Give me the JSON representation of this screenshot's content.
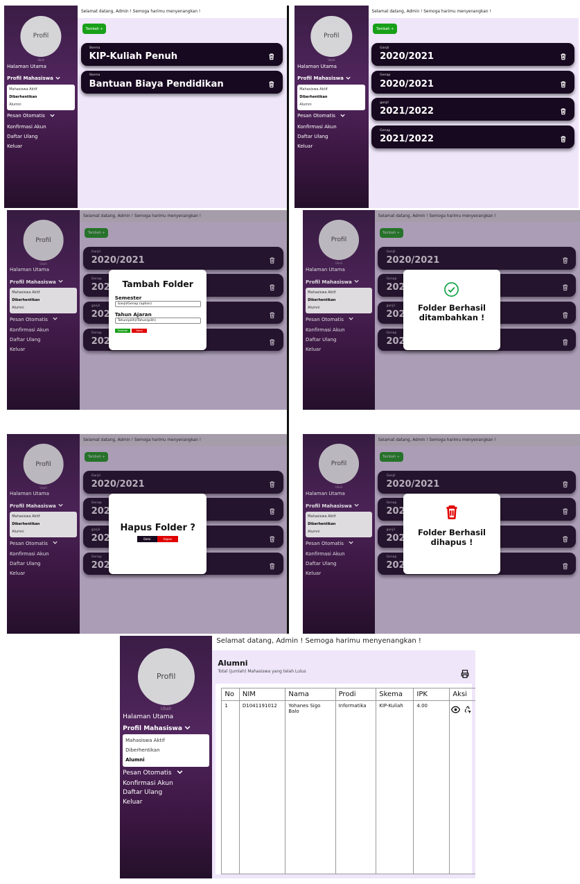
{
  "header_greeting": "Selamat datang, Admin ! Semoga harimu menyenangkan !",
  "sidebar": {
    "profile_label": "Profil",
    "edit_link": "Ubah",
    "nav": {
      "home": "Halaman Utama",
      "student_profile": "Profil Mahasiswa",
      "auto_message": "Pesan Otomatis",
      "account_confirm": "Konfirmasi Akun",
      "re_register": "Daftar Ulang",
      "logout": "Keluar"
    },
    "submenu": {
      "active": "Mahasiswa Aktif",
      "stopped": "Diberhentikan",
      "alumni": "Alumni"
    }
  },
  "add_button": "Tambah +",
  "scheme_folders": [
    {
      "label": "Skema",
      "title": "KIP-Kuliah Penuh"
    },
    {
      "label": "Skema",
      "title": "Bantuan Biaya Pendidikan"
    }
  ],
  "semester_folders": [
    {
      "label": "Ganjil",
      "title": "2020/2021"
    },
    {
      "label": "Genap",
      "title": "2020/2021"
    },
    {
      "label": "ganjil",
      "title": "2021/2022"
    },
    {
      "label": "Genap",
      "title": "2021/2022"
    }
  ],
  "add_folder_modal": {
    "title": "Tambah Folder",
    "semester_label": "Semester",
    "semester_placeholder": "Ganjil/Genap (option)",
    "year_label": "Tahun Ajaran",
    "year_placeholder": "Tahun(pilih)/Tahun(pilih)",
    "submit": "Tambah",
    "cancel": "Batal"
  },
  "added_modal": {
    "line1": "Folder Berhasil",
    "line2": "ditambahkan !"
  },
  "delete_modal": {
    "title": "Hapus Folder ?",
    "cancel": "Batal",
    "confirm": "Hapus"
  },
  "deleted_modal": {
    "line1": "Folder Berhasil",
    "line2": "dihapus !"
  },
  "alumni_page": {
    "title": "Alumni",
    "subtitle": "Total (jumlah) Mahasiswa yang telah Lulus",
    "columns": [
      "No",
      "NIM",
      "Nama",
      "Prodi",
      "Skema",
      "IPK",
      "Aksi"
    ],
    "rows": [
      [
        "1",
        "D1041191012",
        "Yohanes Sigo Balo",
        "Informatika",
        "KIP-Kuliah",
        "4.00"
      ]
    ]
  },
  "colors": {
    "sidebar_top": "#3a1d45",
    "content_bg": "#efe6fa",
    "card_bg": "#17091f",
    "add_green": "#19a019",
    "danger_red": "#e00000",
    "success_green": "#16a34a"
  },
  "icons": [
    "trash-icon",
    "chevron-down-icon",
    "check-circle-icon",
    "printer-icon",
    "eye-icon",
    "recycle-icon"
  ]
}
